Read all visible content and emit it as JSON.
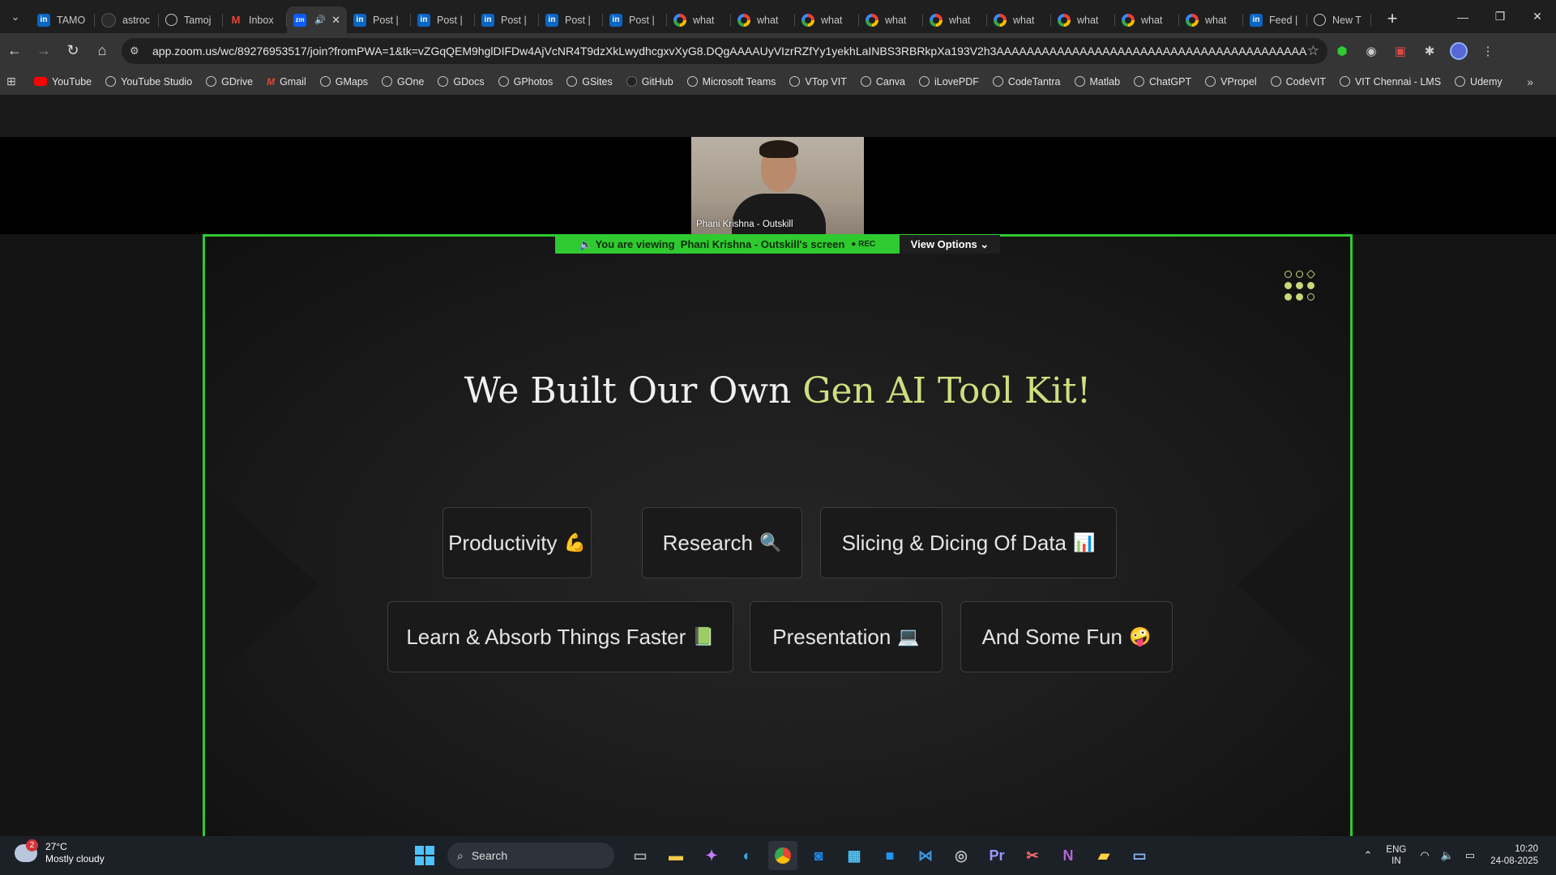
{
  "browser": {
    "tabs": [
      {
        "title": "TAMO",
        "icon": "linkedin-icon"
      },
      {
        "title": "astroc",
        "icon": "github-icon"
      },
      {
        "title": "Tamoj",
        "icon": "globe-icon"
      },
      {
        "title": "Inbox",
        "icon": "gmail-icon"
      },
      {
        "title": "",
        "icon": "zoom-icon",
        "active": true
      },
      {
        "title": "Post |",
        "icon": "linkedin-icon"
      },
      {
        "title": "Post |",
        "icon": "linkedin-icon"
      },
      {
        "title": "Post |",
        "icon": "linkedin-icon"
      },
      {
        "title": "Post |",
        "icon": "linkedin-icon"
      },
      {
        "title": "Post |",
        "icon": "linkedin-icon"
      },
      {
        "title": "what",
        "icon": "google-icon"
      },
      {
        "title": "what",
        "icon": "google-icon"
      },
      {
        "title": "what",
        "icon": "google-icon"
      },
      {
        "title": "what",
        "icon": "google-icon"
      },
      {
        "title": "what",
        "icon": "google-icon"
      },
      {
        "title": "what",
        "icon": "google-icon"
      },
      {
        "title": "what",
        "icon": "google-icon"
      },
      {
        "title": "what",
        "icon": "google-icon"
      },
      {
        "title": "what",
        "icon": "google-icon"
      },
      {
        "title": "Feed |",
        "icon": "linkedin-icon"
      },
      {
        "title": "New T",
        "icon": "chrome-icon"
      }
    ],
    "url": "app.zoom.us/wc/89276953517/join?fromPWA=1&tk=vZGqQEM9hglDIFDw4AjVcNR4T9dzXkLwydhcgxvXyG8.DQgAAAAUyVIzrRZfYy1yekhLaINBS3RBRkpXa193V2h3AAAAAAAAAAAAAAAAAAAAAAAAAAAAAAAAAAAAAAAAAA&_x_zm_r...",
    "bookmarks": [
      "YouTube",
      "YouTube Studio",
      "GDrive",
      "Gmail",
      "GMaps",
      "GOne",
      "GDocs",
      "GPhotos",
      "GSites",
      "GitHub",
      "Microsoft Teams",
      "VTop VIT",
      "Canva",
      "iLovePDF",
      "CodeTantra",
      "Matlab",
      "ChatGPT",
      "VPropel",
      "CodeVIT",
      "VIT Chennai - LMS",
      "Udemy"
    ]
  },
  "zoom": {
    "participant_name": "Phani Krishna - Outskill",
    "viewing_prefix": "You are viewing",
    "viewing_name": "Phani Krishna - Outskill's screen",
    "rec_label": "REC",
    "view_options_label": "View Options"
  },
  "slide": {
    "title_plain": "We Built Our Own ",
    "title_highlight": "Gen AI Tool Kit!",
    "chips": [
      {
        "label": "Productivity",
        "emoji": "💪"
      },
      {
        "label": "Research",
        "emoji": "🔍"
      },
      {
        "label": "Slicing & Dicing Of Data",
        "emoji": "📊"
      },
      {
        "label": "Learn & Absorb Things Faster",
        "emoji": "📗"
      },
      {
        "label": "Presentation",
        "emoji": "💻"
      },
      {
        "label": "And Some Fun",
        "emoji": "🤪"
      }
    ]
  },
  "taskbar": {
    "weather_badge": "2",
    "temperature": "27°C",
    "weather_desc": "Mostly cloudy",
    "search_label": "Search",
    "lang_top": "ENG",
    "lang_bottom": "IN",
    "time": "10:20",
    "date": "24-08-2025"
  },
  "colors": {
    "share_border": "#2fca2f",
    "title_highlight": "#cddf7e"
  }
}
